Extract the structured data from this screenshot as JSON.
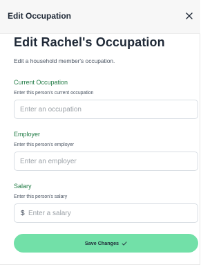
{
  "dialog": {
    "title": "Edit Occupation",
    "close_icon": "close-icon"
  },
  "form": {
    "heading": "Edit Rachel's Occupation",
    "description": "Edit a household member's occupation."
  },
  "fields": {
    "occupation": {
      "label": "Current Occupation",
      "help": "Enter this person's current occupation",
      "value": "",
      "placeholder": "Enter an occupation"
    },
    "employer": {
      "label": "Employer",
      "help": "Enter this person's employer",
      "value": "",
      "placeholder": "Enter an employer"
    },
    "salary": {
      "label": "Salary",
      "help": "Enter this person's salary",
      "currency_symbol": "$",
      "value": "",
      "placeholder": "Enter a salary"
    }
  },
  "actions": {
    "save_label": "Save Changes",
    "save_icon": "check-icon"
  },
  "colors": {
    "accent": "#72e0a8",
    "label_green": "#1f7a43"
  }
}
